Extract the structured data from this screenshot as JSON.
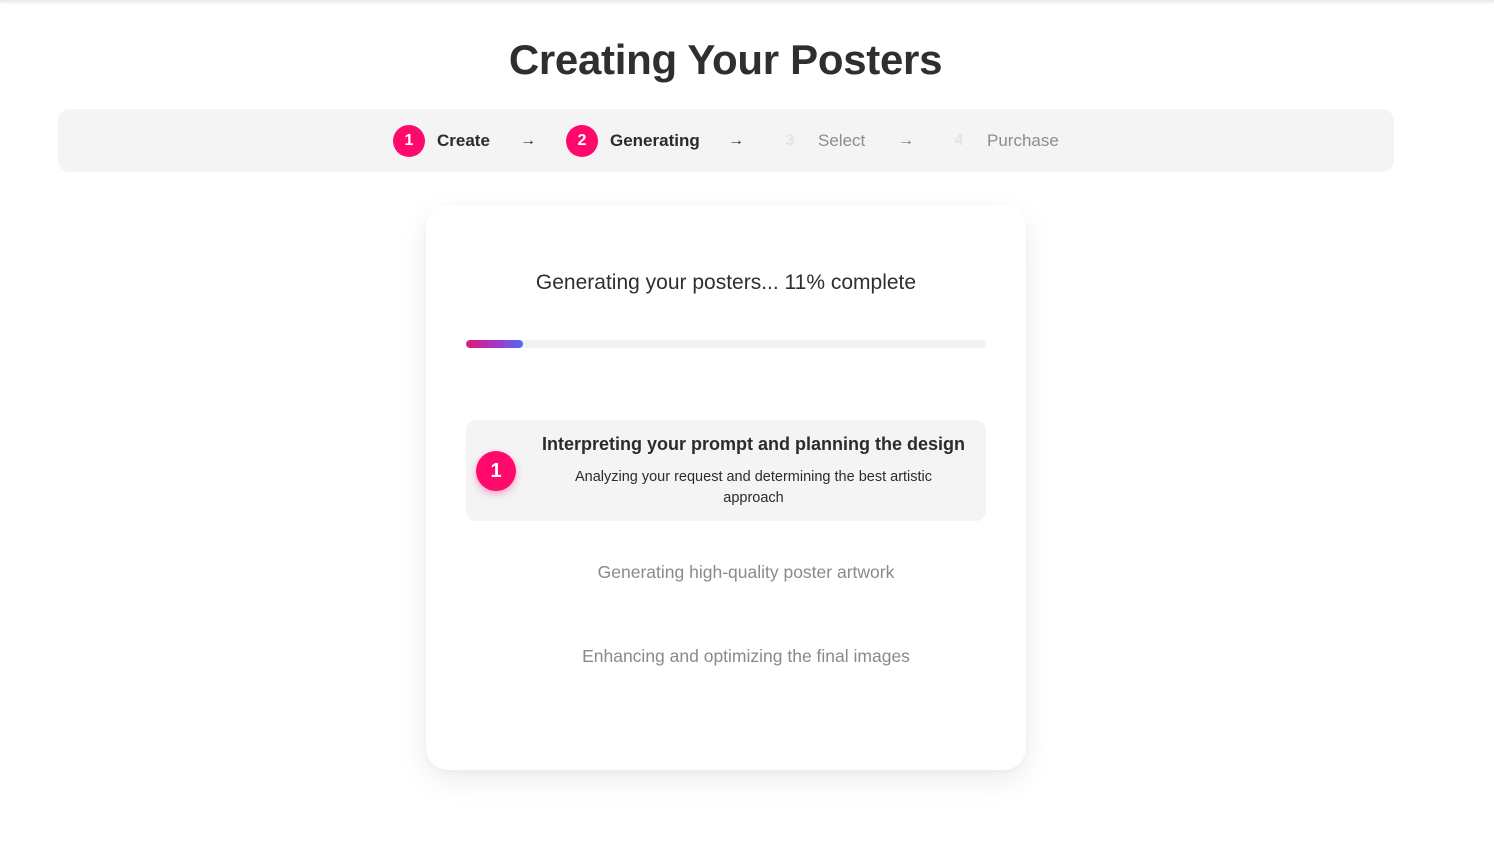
{
  "page": {
    "title": "Creating Your Posters"
  },
  "stepper": {
    "steps": [
      {
        "number": "1",
        "label": "Create",
        "state": "active"
      },
      {
        "number": "2",
        "label": "Generating",
        "state": "active"
      },
      {
        "number": "3",
        "label": "Select",
        "state": "inactive"
      },
      {
        "number": "4",
        "label": "Purchase",
        "state": "inactive"
      }
    ],
    "separator_icon": "arrow-right-icon"
  },
  "progress": {
    "status_text": "Generating your posters... 11% complete",
    "percent": 11
  },
  "tasks": {
    "current": {
      "number": "1",
      "title": "Interpreting your prompt and planning the design",
      "description": "Analyzing your request and determining the best artistic approach"
    },
    "pending": [
      {
        "label": "Generating high-quality poster artwork"
      },
      {
        "label": "Enhancing and optimizing the final images"
      }
    ]
  },
  "colors": {
    "accent": "#ff0a6c",
    "progress_start": "#e0167a",
    "progress_end": "#4a6ef0"
  }
}
